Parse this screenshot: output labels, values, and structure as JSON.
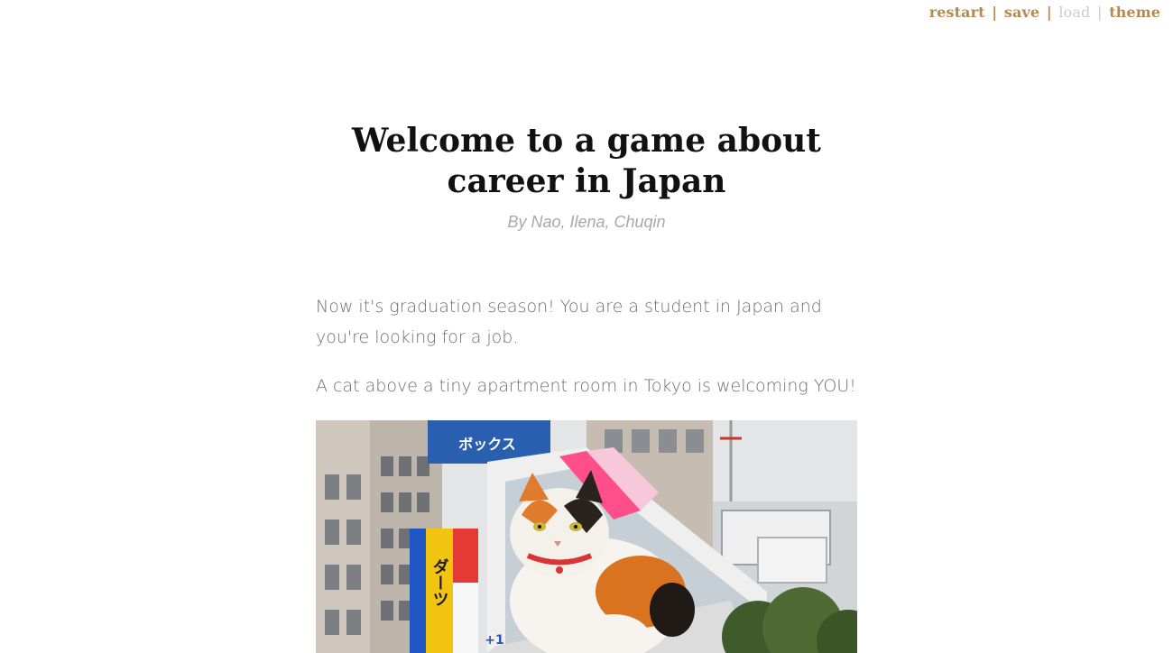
{
  "menu": {
    "restart": "restart",
    "save": "save",
    "load": "load",
    "theme": "theme",
    "separator": "|"
  },
  "header": {
    "title": "Welcome to a game about career in Japan",
    "byline": "By Nao, Ilena, Chuqin"
  },
  "story": {
    "paragraphs": [
      "Now it's graduation season! You are a student in Japan and you're looking for a job.",
      "A cat above a tiny apartment room in Tokyo is welcoming YOU!"
    ]
  },
  "image": {
    "subject": "giant 3D calico cat billboard on a Tokyo building",
    "signs": {
      "left_top": "ボックス",
      "vertical_left": "ダーツ",
      "counter": "+1"
    }
  },
  "colors": {
    "menu_link": "#b5894f",
    "menu_disabled": "#cccccc",
    "title": "#111111",
    "byline": "#a8a8a8",
    "story_text": "#6e6e6e"
  }
}
